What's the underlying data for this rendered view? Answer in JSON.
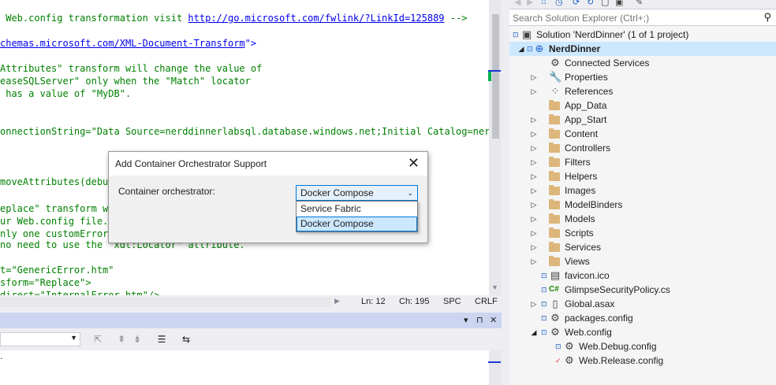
{
  "editor": {
    "lines": [
      {
        "segments": [
          {
            "t": " Web.config transformation visit ",
            "c": "c-comment"
          },
          {
            "t": "http://go.microsoft.com/fwlink/?LinkId=125889",
            "c": "c-link"
          },
          {
            "t": " -->",
            "c": "c-comment"
          }
        ]
      },
      {
        "segments": [
          {
            "t": "chemas.microsoft.com/XML-Document-Transform",
            "c": "c-link"
          },
          {
            "t": "\">",
            "c": "c-blue"
          }
        ]
      },
      {
        "segments": [
          {
            "t": "Attributes\" transform will change the value of",
            "c": "c-comment"
          }
        ]
      },
      {
        "segments": [
          {
            "t": "easeSQLServer\" only when the \"Match\" locator",
            "c": "c-comment"
          }
        ]
      },
      {
        "segments": [
          {
            "t": " has a value of \"MyDB\".",
            "c": "c-comment"
          }
        ]
      },
      {
        "segments": [
          {
            "t": "onnectionString=\"Data Source=nerddinnerlabsql.database.windows.net;Initial Catalog=nerddi",
            "c": "c-comment"
          }
        ]
      },
      {
        "segments": [
          {
            "t": "moveAttributes(debug",
            "c": "c-comment"
          }
        ]
      },
      {
        "segments": [
          {
            "t": "eplace\" transform wi",
            "c": "c-comment"
          }
        ]
      },
      {
        "segments": [
          {
            "t": "ur Web.config file.",
            "c": "c-comment"
          }
        ]
      },
      {
        "segments": [
          {
            "t": "nly one customErrors",
            "c": "c-comment"
          }
        ]
      },
      {
        "segments": [
          {
            "t": "no need to use the \"xdt:Locator\" attribute.",
            "c": "c-comment"
          }
        ]
      },
      {
        "segments": [
          {
            "t": "t=\"GenericError.htm\"",
            "c": "c-comment"
          }
        ]
      },
      {
        "segments": [
          {
            "t": "sform=\"Replace\">",
            "c": "c-comment"
          }
        ]
      },
      {
        "segments": [
          {
            "t": "direct=\"InternalError.htm\"/>",
            "c": "c-comment"
          }
        ]
      }
    ],
    "status": {
      "line": "Ln: 12",
      "col": "Ch: 195",
      "mode": "SPC",
      "eol": "CRLF"
    }
  },
  "tool_window": {
    "header_buttons": [
      "▾",
      "⊓",
      "✕"
    ],
    "body_text": "."
  },
  "solution_explorer": {
    "search_placeholder": "Search Solution Explorer (Ctrl+;)",
    "items": [
      {
        "label": "Solution 'NerdDinner' (1 of 1 project)",
        "icon": "solution-icon",
        "depth": 0,
        "expander": "",
        "lock": true
      },
      {
        "label": "NerdDinner",
        "icon": "web-project-icon",
        "depth": 0,
        "expander": "▲",
        "lock": true,
        "selected": true,
        "bold": true
      },
      {
        "label": "Connected Services",
        "icon": "connected-services-icon",
        "depth": 1,
        "expander": "",
        "lock": false
      },
      {
        "label": "Properties",
        "icon": "wrench-icon",
        "depth": 1,
        "expander": "▶",
        "lock": false
      },
      {
        "label": "References",
        "icon": "references-icon",
        "depth": 1,
        "expander": "▶",
        "lock": false
      },
      {
        "label": "App_Data",
        "icon": "folder-icon",
        "depth": 1,
        "expander": "",
        "lock": false
      },
      {
        "label": "App_Start",
        "icon": "folder-icon",
        "depth": 1,
        "expander": "▶",
        "lock": false
      },
      {
        "label": "Content",
        "icon": "folder-icon",
        "depth": 1,
        "expander": "▶",
        "lock": false
      },
      {
        "label": "Controllers",
        "icon": "folder-icon",
        "depth": 1,
        "expander": "▶",
        "lock": false
      },
      {
        "label": "Filters",
        "icon": "folder-icon",
        "depth": 1,
        "expander": "▶",
        "lock": false
      },
      {
        "label": "Helpers",
        "icon": "folder-icon",
        "depth": 1,
        "expander": "▶",
        "lock": false
      },
      {
        "label": "Images",
        "icon": "folder-icon",
        "depth": 1,
        "expander": "▶",
        "lock": false
      },
      {
        "label": "ModelBinders",
        "icon": "folder-icon",
        "depth": 1,
        "expander": "▶",
        "lock": false
      },
      {
        "label": "Models",
        "icon": "folder-icon",
        "depth": 1,
        "expander": "▶",
        "lock": false
      },
      {
        "label": "Scripts",
        "icon": "folder-icon",
        "depth": 1,
        "expander": "▶",
        "lock": false
      },
      {
        "label": "Services",
        "icon": "folder-icon",
        "depth": 1,
        "expander": "▶",
        "lock": false
      },
      {
        "label": "Views",
        "icon": "folder-icon",
        "depth": 1,
        "expander": "▶",
        "lock": false
      },
      {
        "label": "favicon.ico",
        "icon": "image-file-icon",
        "depth": 1,
        "expander": "",
        "lock": true
      },
      {
        "label": "GlimpseSecurityPolicy.cs",
        "icon": "csharp-file-icon",
        "depth": 1,
        "expander": "",
        "lock": true
      },
      {
        "label": "Global.asax",
        "icon": "file-icon",
        "depth": 1,
        "expander": "▶",
        "lock": true
      },
      {
        "label": "packages.config",
        "icon": "config-file-icon",
        "depth": 1,
        "expander": "",
        "lock": true
      },
      {
        "label": "Web.config",
        "icon": "config-file-icon",
        "depth": 1,
        "expander": "▲",
        "lock": true
      },
      {
        "label": "Web.Debug.config",
        "icon": "config-file-icon",
        "depth": 2,
        "expander": "",
        "lock": true
      },
      {
        "label": "Web.Release.config",
        "icon": "config-file-icon",
        "depth": 2,
        "expander": "",
        "lock": false,
        "checkmark": true
      }
    ]
  },
  "dialog": {
    "title": "Add Container Orchestrator Support",
    "label": "Container orchestrator:",
    "selected_value": "Docker Compose",
    "options": [
      "Service Fabric",
      "Docker Compose"
    ],
    "highlighted_option": "Docker Compose"
  }
}
